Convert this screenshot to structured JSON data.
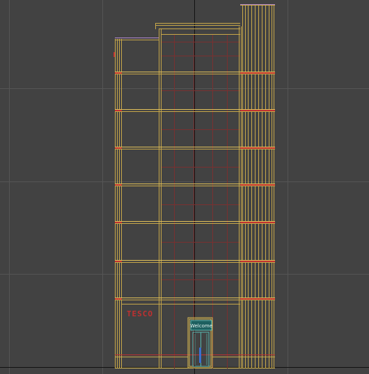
{
  "viewport": {
    "background": "#424242",
    "grid_color": "#555555",
    "axis_color": "#111111",
    "model_color": "#c8a84a",
    "model_color_bright": "#e2c25a",
    "glass_color": "#7a3030",
    "accent_red": "#c03030",
    "top_outline_color": "#b58ad0",
    "door_color": "#58b8b0"
  },
  "labels": {
    "signage": "TESCO",
    "door_sign": "Welcome"
  }
}
